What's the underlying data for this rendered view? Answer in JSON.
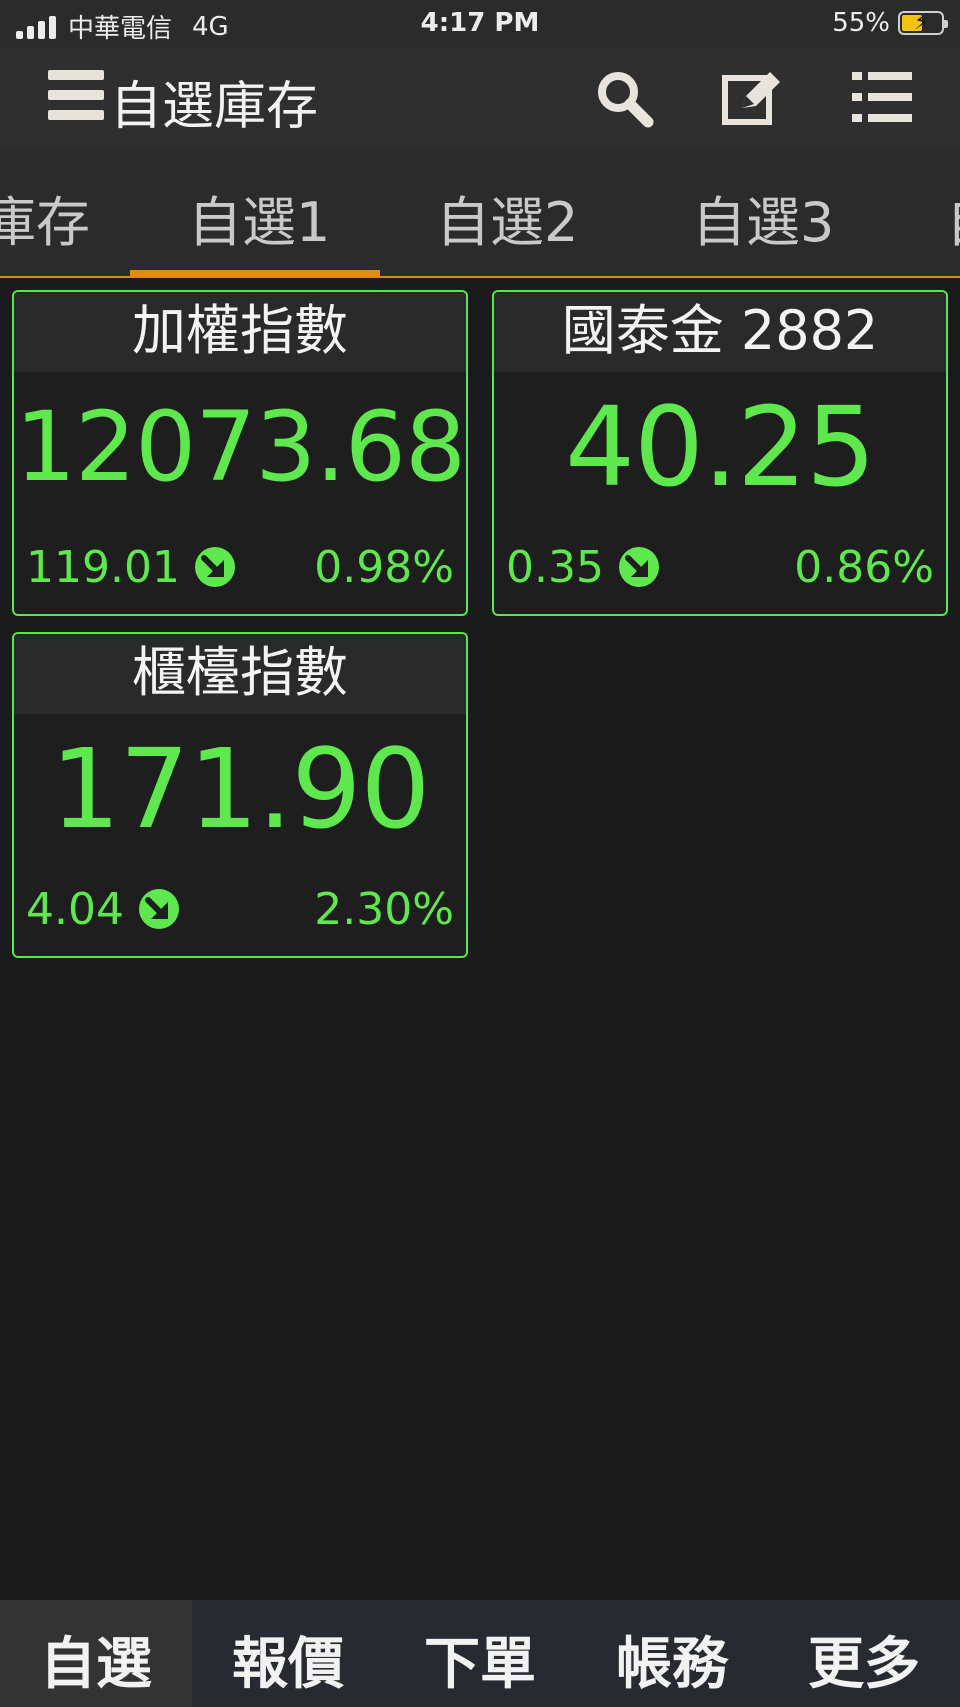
{
  "status_bar": {
    "carrier": "中華電信",
    "network": "4G",
    "time": "4:17 PM",
    "battery": "55%"
  },
  "app_bar": {
    "title": "自選庫存"
  },
  "tabs": [
    {
      "label": "庫存"
    },
    {
      "label": "自選1",
      "active": true
    },
    {
      "label": "自選2"
    },
    {
      "label": "自選3"
    },
    {
      "label": "自"
    }
  ],
  "cards": [
    {
      "name": "加權指數",
      "price": "12073.68",
      "change": "119.01",
      "percent": "0.98%",
      "direction": "down"
    },
    {
      "name": "國泰金 2882",
      "price": "40.25",
      "change": "0.35",
      "percent": "0.86%",
      "direction": "down"
    },
    {
      "name": "櫃檯指數",
      "price": "171.90",
      "change": "4.04",
      "percent": "2.30%",
      "direction": "down"
    }
  ],
  "bottom_nav": [
    {
      "label": "自選",
      "active": true
    },
    {
      "label": "報價"
    },
    {
      "label": "下單"
    },
    {
      "label": "帳務"
    },
    {
      "label": "更多"
    }
  ],
  "colors": {
    "down": "#5fe84e",
    "tab_indicator": "#e08c17",
    "background": "#1b1b1b"
  },
  "icons": {
    "menu": "hamburger-icon",
    "search": "search-icon",
    "edit": "edit-icon",
    "list": "list-icon",
    "down_arrow": "down-arrow-icon"
  }
}
